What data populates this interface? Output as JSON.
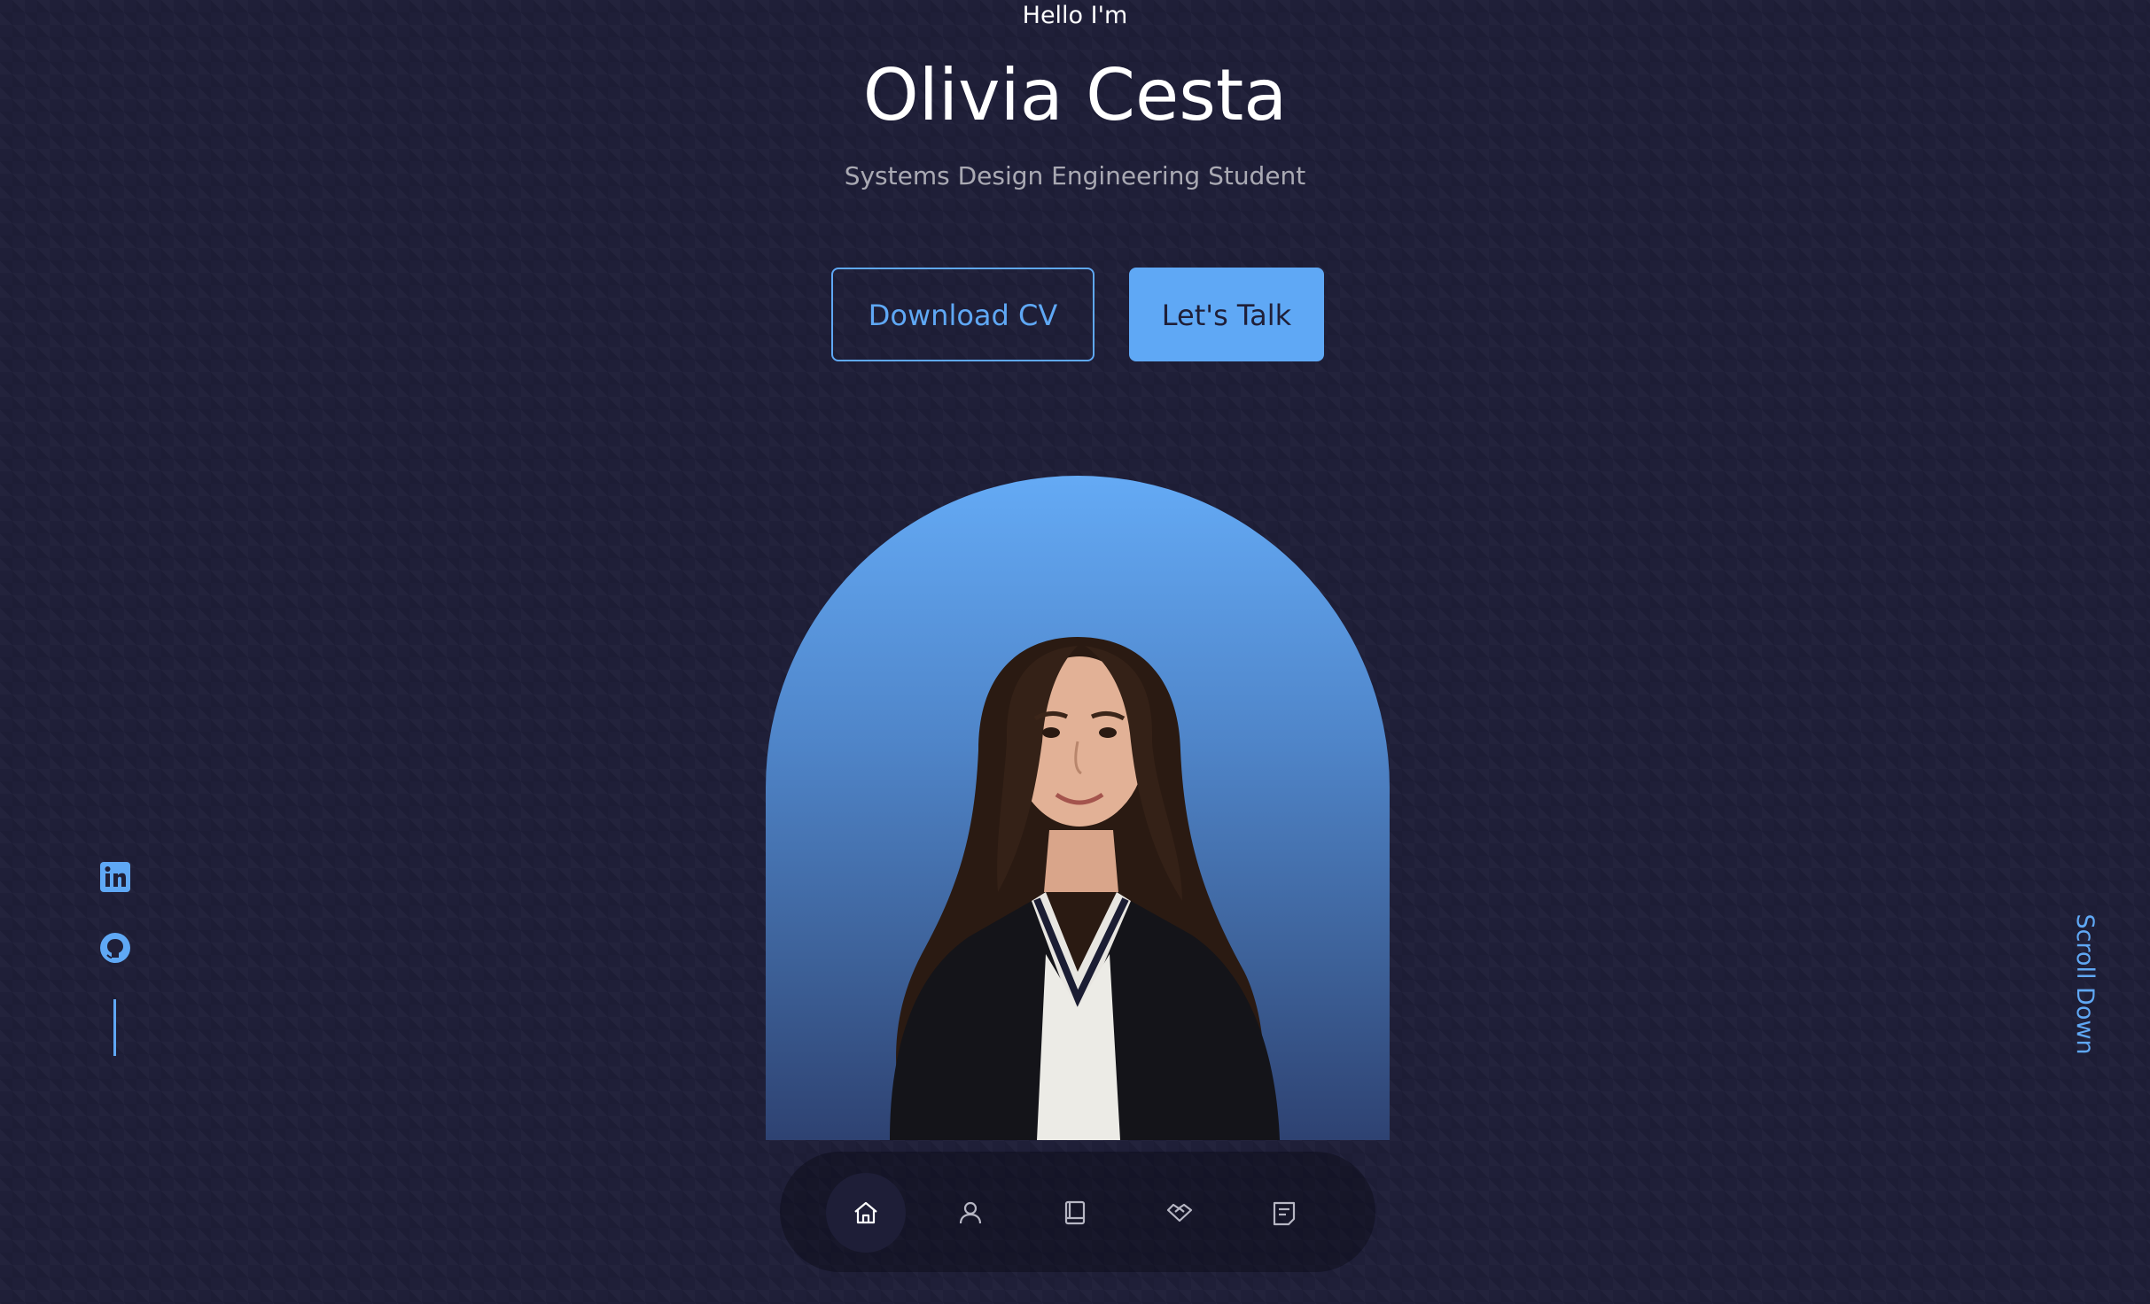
{
  "hero": {
    "greeting": "Hello I'm",
    "name": "Olivia Cesta",
    "subtitle": "Systems Design Engineering Student"
  },
  "buttons": {
    "download_cv": "Download CV",
    "lets_talk": "Let's Talk"
  },
  "portrait": {
    "icon": "portrait-photo"
  },
  "socials": [
    {
      "name": "LinkedIn",
      "icon": "linkedin-icon"
    },
    {
      "name": "GitHub",
      "icon": "github-icon"
    }
  ],
  "scroll": {
    "label": "Scroll Down"
  },
  "nav": {
    "items": [
      {
        "icon": "home-icon",
        "active": true
      },
      {
        "icon": "user-icon",
        "active": false
      },
      {
        "icon": "book-icon",
        "active": false
      },
      {
        "icon": "handshake-icon",
        "active": false
      },
      {
        "icon": "message-icon",
        "active": false
      }
    ]
  },
  "colors": {
    "background": "#1f1f38",
    "accent": "#5fa8f5",
    "text": "#ffffff"
  }
}
